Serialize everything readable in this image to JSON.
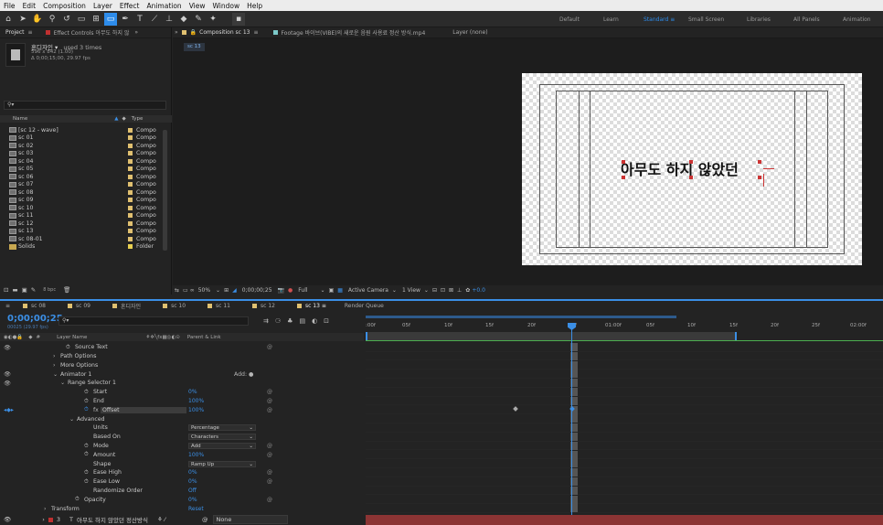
{
  "menu": [
    "File",
    "Edit",
    "Composition",
    "Layer",
    "Effect",
    "Animation",
    "View",
    "Window",
    "Help"
  ],
  "workspaces": [
    {
      "label": "Default",
      "active": false
    },
    {
      "label": "Learn",
      "active": false
    },
    {
      "label": "Standard",
      "active": true
    },
    {
      "label": "Small Screen",
      "active": false
    },
    {
      "label": "Libraries",
      "active": false
    },
    {
      "label": "All Panels",
      "active": false
    },
    {
      "label": "Animation",
      "active": false
    }
  ],
  "project": {
    "tab_project": "Project",
    "tab_effects": "Effect Controls 아무도 하지 않",
    "selected_name": "혼디자인",
    "used": "used 3 times",
    "dims": "596 x 842 (1.00)",
    "duration": "Δ 0;00;15;00, 29.97 fps",
    "col_name": "Name",
    "col_type": "Type",
    "items": [
      {
        "name": "[sc 12 - wave]",
        "type": "Compo",
        "color": "#e0c070"
      },
      {
        "name": "sc 01",
        "type": "Compo",
        "color": "#e0c070"
      },
      {
        "name": "sc 02",
        "type": "Compo",
        "color": "#e0c070"
      },
      {
        "name": "sc 03",
        "type": "Compo",
        "color": "#e0c070"
      },
      {
        "name": "sc 04",
        "type": "Compo",
        "color": "#e0c070"
      },
      {
        "name": "sc 05",
        "type": "Compo",
        "color": "#e0c070"
      },
      {
        "name": "sc 06",
        "type": "Compo",
        "color": "#e0c070"
      },
      {
        "name": "sc 07",
        "type": "Compo",
        "color": "#e0c070"
      },
      {
        "name": "sc 08",
        "type": "Compo",
        "color": "#e0c070"
      },
      {
        "name": "sc 09",
        "type": "Compo",
        "color": "#e0c070"
      },
      {
        "name": "sc 10",
        "type": "Compo",
        "color": "#e0c070"
      },
      {
        "name": "sc 11",
        "type": "Compo",
        "color": "#e0c070"
      },
      {
        "name": "sc 12",
        "type": "Compo",
        "color": "#e0c070"
      },
      {
        "name": "sc 13",
        "type": "Compo",
        "color": "#e0c070"
      },
      {
        "name": "sc 08-01",
        "type": "Compo",
        "color": "#e0c070"
      },
      {
        "name": "Solids",
        "type": "Folder",
        "color": "#e8d050"
      }
    ],
    "bpc": "8 bpc"
  },
  "comp": {
    "tab_comp": "Composition sc 13",
    "tab_footage": "Footage 바이브(VIBE)의 새로운 음원 사용료 정산 방식.mp4",
    "tab_layer": "Layer (none)",
    "subtab": "sc 13",
    "text": "아무도 하지 않았던",
    "zoom": "50%",
    "timecode": "0;00;00;25",
    "resolution": "Full",
    "camera": "Active Camera",
    "view": "1 View",
    "exposure": "+0.0"
  },
  "timeline": {
    "tabs": [
      "sc 08",
      "sc 09",
      "혼디자인",
      "sc 10",
      "sc 11",
      "sc 12",
      "sc 13",
      "Render Queue"
    ],
    "active_tab": "sc 13",
    "timecode": "0;00;00;25",
    "frames": "00025 (29.97 fps)",
    "col_layer": "Layer Name",
    "col_parent": "Parent & Link",
    "ruler": [
      ":00f",
      "05f",
      "10f",
      "15f",
      "20f",
      "25f",
      "01:00f",
      "05f",
      "10f",
      "15f",
      "20f",
      "25f",
      "02:00f"
    ],
    "rows": [
      {
        "indent": 72,
        "label": "Source Text",
        "stopwatch": true
      },
      {
        "indent": 66,
        "label": "Path Options",
        "arrow": "›"
      },
      {
        "indent": 66,
        "label": "More Options",
        "arrow": "›"
      },
      {
        "indent": 66,
        "label": "Animator 1",
        "arrow": "⌄",
        "extra": "Add:"
      },
      {
        "indent": 74,
        "label": "Range Selector 1",
        "arrow": "⌄"
      },
      {
        "indent": 92,
        "label": "Start",
        "stopwatch": true,
        "value": "0%"
      },
      {
        "indent": 92,
        "label": "End",
        "stopwatch": true,
        "value": "100%"
      },
      {
        "indent": 92,
        "label": "Offset",
        "stopwatch": true,
        "value": "100%",
        "selected": true
      },
      {
        "indent": 84,
        "label": "Advanced",
        "arrow": "⌄"
      },
      {
        "indent": 102,
        "label": "Units",
        "dropdown": "Percentage"
      },
      {
        "indent": 102,
        "label": "Based On",
        "dropdown": "Characters"
      },
      {
        "indent": 92,
        "label": "Mode",
        "stopwatch": true,
        "dropdown": "Add"
      },
      {
        "indent": 92,
        "label": "Amount",
        "stopwatch": true,
        "value": "100%"
      },
      {
        "indent": 102,
        "label": "Shape",
        "dropdown": "Ramp Up"
      },
      {
        "indent": 92,
        "label": "Ease High",
        "stopwatch": true,
        "value": "0%"
      },
      {
        "indent": 92,
        "label": "Ease Low",
        "stopwatch": true,
        "value": "0%"
      },
      {
        "indent": 102,
        "label": "Randomize Order",
        "value": "Off"
      },
      {
        "indent": 82,
        "label": "Opacity",
        "stopwatch": true,
        "value": "0%"
      },
      {
        "indent": 56,
        "label": "Transform",
        "arrow": "›",
        "value": "Reset"
      }
    ],
    "layer3": {
      "num": "3",
      "name": "아무도 하지 않았던 정산방식",
      "parent": "None"
    }
  },
  "colors": {
    "accent": "#2d8ceb",
    "layer_red": "#b04040",
    "work_area": "#2d8ceb",
    "keyframe_blue": "#3b8fe6"
  }
}
